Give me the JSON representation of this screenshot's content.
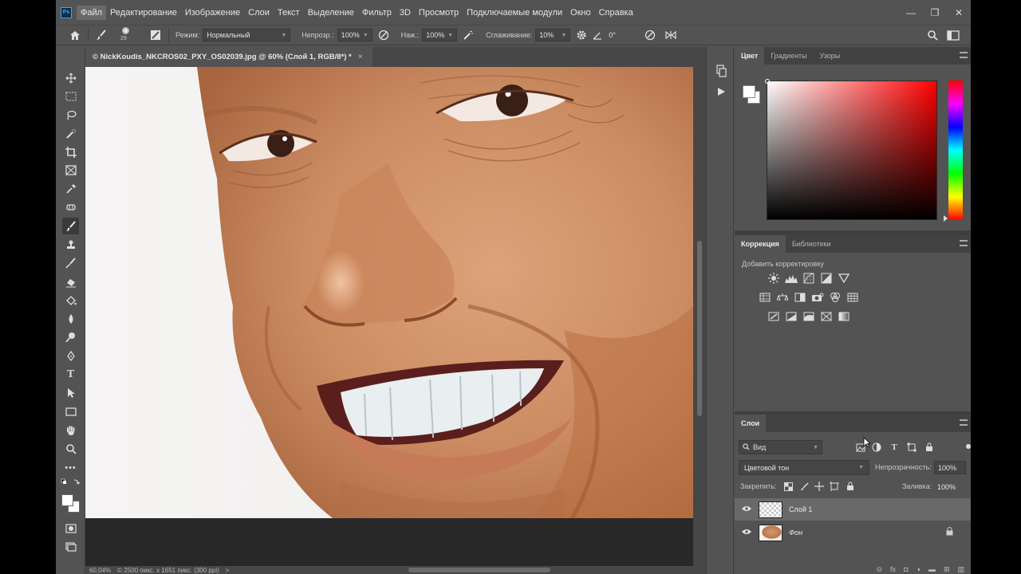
{
  "app": {
    "logo": "Ps",
    "menu": [
      "Файл",
      "Редактирование",
      "Изображение",
      "Слои",
      "Текст",
      "Выделение",
      "Фильтр",
      "3D",
      "Просмотр",
      "Подключаемые модули",
      "Окно",
      "Справка"
    ],
    "window_controls": [
      "—",
      "❐",
      "✕"
    ]
  },
  "options": {
    "brush_size": "29",
    "mode_label": "Режим:",
    "mode_value": "Нормальный",
    "opacity_label": "Непрозр.:",
    "opacity_value": "100%",
    "pressure_label": "Наж.:",
    "pressure_value": "100%",
    "smoothing_label": "Сглаживание:",
    "smoothing_value": "10%",
    "angle_value": "0°"
  },
  "document": {
    "tab_title": "© NickKoudis_NKCROS02_PXY_OS02039.jpg @ 60% (Слой 1, RGB/8*) *",
    "close": "×"
  },
  "status": {
    "zoom": "60,04%",
    "info": "© 2500 пикс. x 1651 пикс. (300 ppi)",
    "arrow": ">"
  },
  "color_panel": {
    "tabs": [
      "Цвет",
      "Градиенты",
      "Узоры"
    ],
    "foreground": "#ffffff",
    "background": "#ffffff",
    "hue": "#ff0000"
  },
  "adjustments_panel": {
    "tabs": [
      "Коррекция",
      "Библиотеки"
    ],
    "subtitle": "Добавить корректировку"
  },
  "layers_panel": {
    "tab": "Слои",
    "search_placeholder": "Вид",
    "blend_mode": "Цветовой тон",
    "opacity_label": "Непрозрачность:",
    "opacity_value": "100%",
    "lock_label": "Закрепить:",
    "fill_label": "Заливка:",
    "fill_value": "100%",
    "layers": [
      {
        "name": "Слой 1",
        "visible": true,
        "selected": true,
        "locked": false
      },
      {
        "name": "Фон",
        "visible": true,
        "selected": false,
        "locked": true
      }
    ],
    "footer_icons": [
      "link-icon",
      "fx-icon",
      "mask-icon",
      "adjustment-icon",
      "group-icon",
      "new-layer-icon",
      "trash-icon"
    ]
  }
}
